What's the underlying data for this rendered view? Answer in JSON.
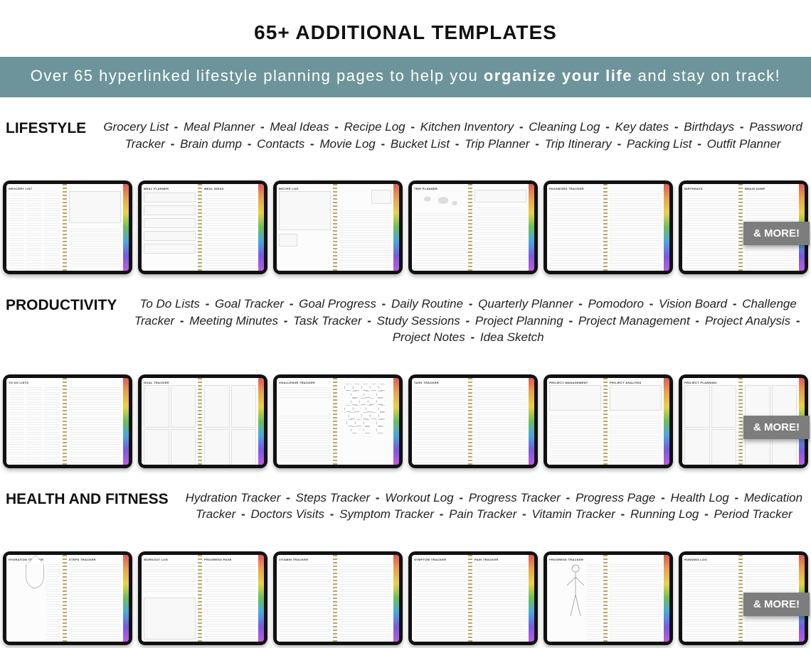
{
  "title": "65+ ADDITIONAL TEMPLATES",
  "banner_pre": "Over 65 hyperlinked lifestyle planning pages to help you ",
  "banner_bold": "organize your life",
  "banner_post": " and stay on track!",
  "more_label": "& MORE!",
  "sections": [
    {
      "label": "LIFESTYLE",
      "items": [
        "Grocery List",
        "Meal Planner",
        "Meal Ideas",
        "Recipe Log",
        "Kitchen Inventory",
        "Cleaning Log",
        "Key dates",
        "Birthdays",
        "Password Tracker",
        "Brain dump",
        "Contacts",
        "Movie Log",
        "Bucket List",
        "Trip Planner",
        "Trip Itinerary",
        "Packing List",
        "Outfit Planner"
      ],
      "thumbs": [
        {
          "left": "GROCERY LIST",
          "right": ""
        },
        {
          "left": "MEAL PLANNER",
          "right": "MEAL IDEAS"
        },
        {
          "left": "RECIPE LOG",
          "right": ""
        },
        {
          "left": "TRIP PLANNER",
          "right": ""
        },
        {
          "left": "PASSWORD TRACKER",
          "right": ""
        },
        {
          "left": "BIRTHDAYS",
          "right": "BRAIN DUMP"
        }
      ]
    },
    {
      "label": "PRODUCTIVITY",
      "items": [
        "To Do Lists",
        "Goal Tracker",
        "Goal Progress",
        "Daily Routine",
        "Quarterly Planner",
        "Pomodoro",
        "Vision Board",
        "Challenge Tracker",
        "Meeting Minutes",
        "Task Tracker",
        "Study Sessions",
        "Project Planning",
        "Project Management",
        "Project Analysis",
        "Project Notes",
        "Idea Sketch"
      ],
      "thumbs": [
        {
          "left": "TO DO LISTS",
          "right": ""
        },
        {
          "left": "GOAL TRACKER",
          "right": ""
        },
        {
          "left": "CHALLENGE TRACKER",
          "right": ""
        },
        {
          "left": "TASK TRACKER",
          "right": ""
        },
        {
          "left": "PROJECT MANAGEMENT",
          "right": "PROJECT ANALYSIS"
        },
        {
          "left": "PROJECT PLANNING",
          "right": ""
        }
      ]
    },
    {
      "label": "HEALTH AND FITNESS",
      "items": [
        "Hydration Tracker",
        "Steps Tracker",
        "Workout Log",
        "Progress Tracker",
        "Progress Page",
        "Health Log",
        "Medication Tracker",
        "Doctors Visits",
        "Symptom Tracker",
        "Pain Tracker",
        "Vitamin Tracker",
        "Running Log",
        "Period Tracker"
      ],
      "thumbs": [
        {
          "left": "HYDRATION TRACKER",
          "right": "STEPS TRACKER"
        },
        {
          "left": "WORKOUT LOG",
          "right": "PROGRESS PAGE"
        },
        {
          "left": "VITAMIN TRACKER",
          "right": ""
        },
        {
          "left": "SYMPTOM TRACKER",
          "right": "PAIN TRACKER"
        },
        {
          "left": "PROGRESS TRACKER",
          "right": ""
        },
        {
          "left": "RUNNING LOG",
          "right": ""
        }
      ]
    }
  ]
}
